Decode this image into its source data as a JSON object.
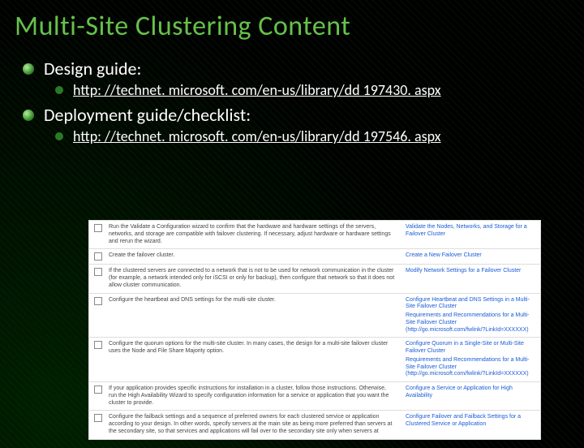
{
  "title": "Multi-Site Clustering Content",
  "bullets": [
    {
      "label": "Design guide:",
      "link": "http: //technet. microsoft. com/en-us/library/dd 197430. aspx"
    },
    {
      "label": "Deployment guide/checklist:",
      "link": "http: //technet. microsoft. com/en-us/library/dd 197546. aspx"
    }
  ],
  "rows": [
    {
      "mid": "Run the Validate a Configuration wizard to confirm that the hardware and hardware settings of the servers, networks, and storage are compatible with failover clustering. If necessary, adjust hardware or hardware settings and rerun the wizard.",
      "right": "Validate the Nodes, Networks, and Storage for a Failover Cluster"
    },
    {
      "mid": "Create the failover cluster.",
      "right": "Create a New Failover Cluster"
    },
    {
      "mid": "If the clustered servers are connected to a network that is not to be used for network communication in the cluster (for example, a network intended only for iSCSI or only for backup), then configure that network so that it does not allow cluster communication.",
      "right": "Modify Network Settings for a Failover Cluster"
    },
    {
      "mid": "Configure the heartbeat and DNS settings for the multi-site cluster.",
      "right": "Configure Heartbeat and DNS Settings in a Multi-Site Failover Cluster",
      "right_sub": "Requirements and Recommendations for a Multi-Site Failover Cluster (http://go.microsoft.com/fwlink/?LinkId=XXXXXX)"
    },
    {
      "mid": "Configure the quorum options for the multi-site cluster. In many cases, the design for a multi-site failover cluster uses the Node and File Share Majority option.",
      "mid_strong": "Node and File Share Majority",
      "right": "Configure Quorum in a Single-Site or Multi-Site Failover Cluster",
      "right_sub": "Requirements and Recommendations for a Multi-Site Failover Cluster (http://go.microsoft.com/fwlink/?LinkId=XXXXXX)"
    },
    {
      "mid": "If your application provides specific instructions for installation in a cluster, follow those instructions. Otherwise, run the High Availability Wizard to specify configuration information for a service or application that you want the cluster to provide.",
      "right": "Configure a Service or Application for High Availability"
    },
    {
      "mid": "Configure the failback settings and a sequence of preferred owners for each clustered service or application according to your design. In other words, specify servers at the main site as being more preferred than servers at the secondary site, so that services and applications will fail over to the secondary site only when servers at",
      "right": "Configure Failover and Failback Settings for a Clustered Service or Application"
    }
  ]
}
